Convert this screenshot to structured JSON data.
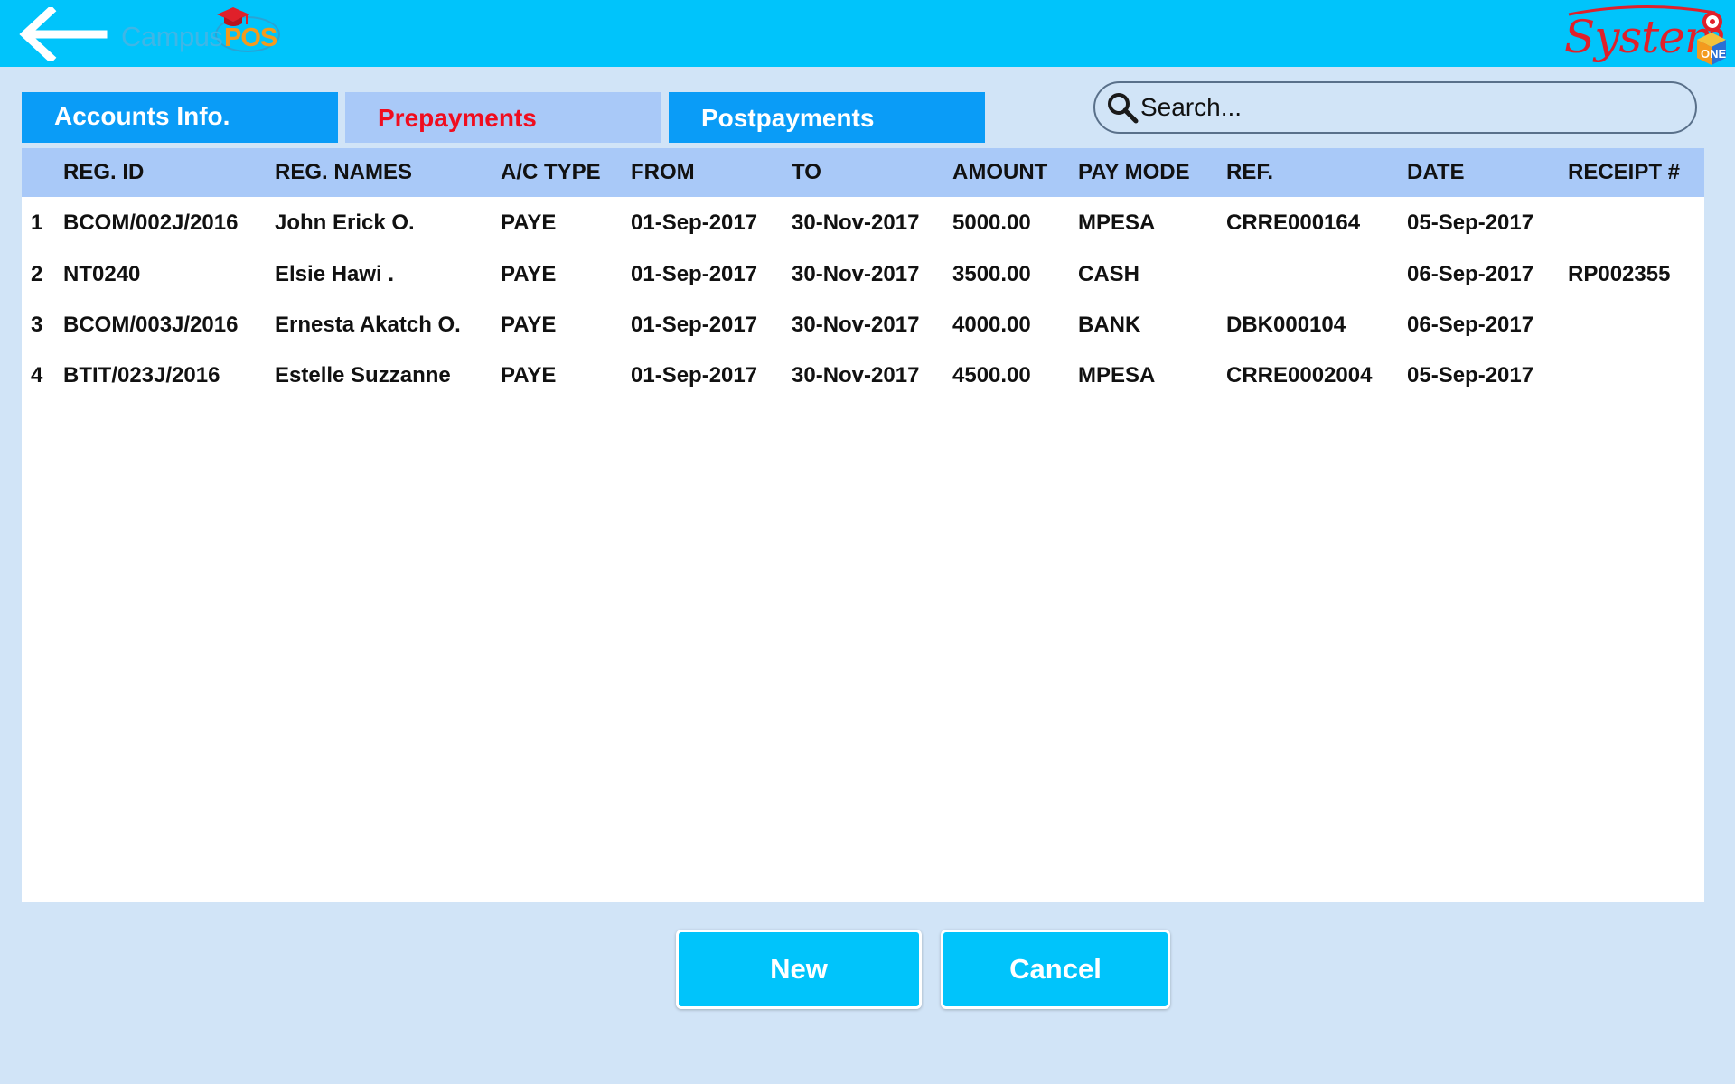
{
  "header": {
    "campus_logo": {
      "campus": "Campus",
      "pos": "POS"
    },
    "system_logo": {
      "system": "System",
      "one": "ONE"
    }
  },
  "tabs": [
    {
      "label": "Accounts Info.",
      "active": false
    },
    {
      "label": "Prepayments",
      "active": true
    },
    {
      "label": "Postpayments",
      "active": false
    }
  ],
  "search": {
    "placeholder": "Search...",
    "value": ""
  },
  "table": {
    "columns": [
      "",
      "REG. ID",
      "REG. NAMES",
      "A/C TYPE",
      "FROM",
      "TO",
      "AMOUNT",
      "PAY MODE",
      "REF.",
      "DATE",
      "RECEIPT #"
    ],
    "rows": [
      [
        "1",
        "BCOM/002J/2016",
        "John Erick O.",
        "PAYE",
        "01-Sep-2017",
        "30-Nov-2017",
        "5000.00",
        "MPESA",
        "CRRE000164",
        "05-Sep-2017",
        ""
      ],
      [
        "2",
        "NT0240",
        "Elsie Hawi .",
        "PAYE",
        "01-Sep-2017",
        "30-Nov-2017",
        "3500.00",
        "CASH",
        "",
        "06-Sep-2017",
        "RP002355"
      ],
      [
        "3",
        "BCOM/003J/2016",
        "Ernesta Akatch O.",
        "PAYE",
        "01-Sep-2017",
        "30-Nov-2017",
        "4000.00",
        "BANK",
        "DBK000104",
        "06-Sep-2017",
        ""
      ],
      [
        "4",
        "BTIT/023J/2016",
        "Estelle Suzzanne",
        "PAYE",
        "01-Sep-2017",
        "30-Nov-2017",
        "4500.00",
        "MPESA",
        "CRRE0002004",
        "05-Sep-2017",
        ""
      ]
    ]
  },
  "actions": {
    "new_label": "New",
    "cancel_label": "Cancel"
  },
  "colors": {
    "topbar": "#00c4fb",
    "background": "#d1e4f7",
    "tab_inactive": "#0a9cf7",
    "tab_active": "#a9c9f8",
    "tab_active_text": "#f00d1f",
    "header_row": "#a9c9f8",
    "button": "#00c4fb"
  },
  "icons": {
    "back": "arrow-left-icon",
    "search": "search-icon"
  }
}
